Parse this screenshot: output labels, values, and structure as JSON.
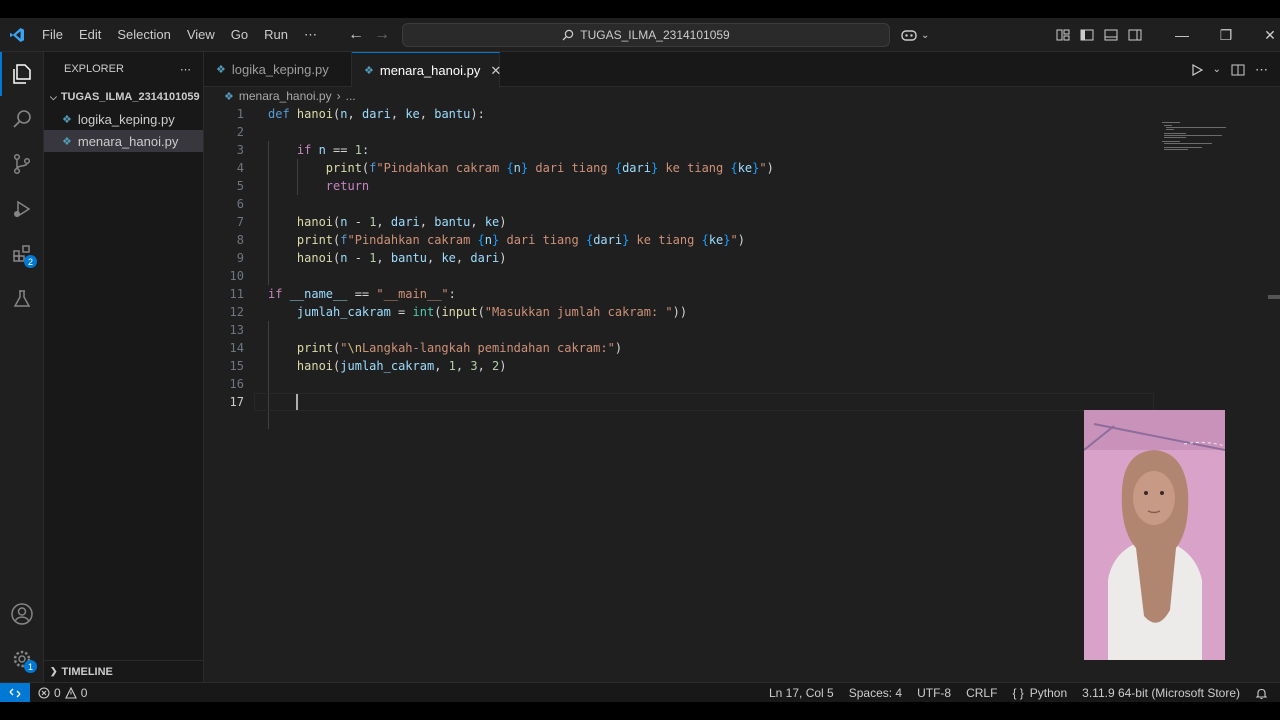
{
  "titlebar": {
    "menu": [
      "File",
      "Edit",
      "Selection",
      "View",
      "Go",
      "Run",
      "⋯"
    ],
    "search_text": "TUGAS_ILMA_2314101059"
  },
  "sidebar": {
    "header": "EXPLORER",
    "more": "⋯",
    "folder": "TUGAS_ILMA_2314101059",
    "files": [
      "logika_keping.py",
      "menara_hanoi.py"
    ],
    "timeline": "TIMELINE"
  },
  "activitybar": {
    "extensions_badge": "2",
    "settings_badge": "1"
  },
  "tabs": [
    {
      "label": "logika_keping.py"
    },
    {
      "label": "menara_hanoi.py",
      "close": "✕"
    }
  ],
  "breadcrumb": {
    "file": "menara_hanoi.py",
    "sep": "›",
    "rest": "..."
  },
  "editor": {
    "line_numbers": [
      "1",
      "2",
      "3",
      "4",
      "5",
      "6",
      "7",
      "8",
      "9",
      "10",
      "11",
      "12",
      "13",
      "14",
      "15",
      "16",
      "17"
    ],
    "lines": [
      "def hanoi(n, dari, ke, bantu):",
      "",
      "    if n == 1:",
      "        print(f\"Pindahkan cakram {n} dari tiang {dari} ke tiang {ke}\")",
      "        return",
      "",
      "    hanoi(n - 1, dari, bantu, ke)",
      "    print(f\"Pindahkan cakram {n} dari tiang {dari} ke tiang {ke}\")",
      "    hanoi(n - 1, bantu, ke, dari)",
      "",
      "if __name__ == \"__main__\":",
      "    jumlah_cakram = int(input(\"Masukkan jumlah cakram: \"))",
      "",
      "    print(\"\\nLangkah-langkah pemindahan cakram:\")",
      "    hanoi(jumlah_cakram, 1, 3, 2)",
      "",
      ""
    ],
    "current_line": 17
  },
  "statusbar": {
    "errors": "0",
    "warnings": "0",
    "position": "Ln 17, Col 5",
    "spaces": "Spaces: 4",
    "encoding": "UTF-8",
    "eol": "CRLF",
    "braces": "{ }",
    "language": "Python",
    "interpreter": "3.11.9 64-bit (Microsoft Store)"
  },
  "colors": {
    "accent": "#0078d4",
    "editor_bg": "#1f1f1f",
    "sidebar_bg": "#181818"
  }
}
